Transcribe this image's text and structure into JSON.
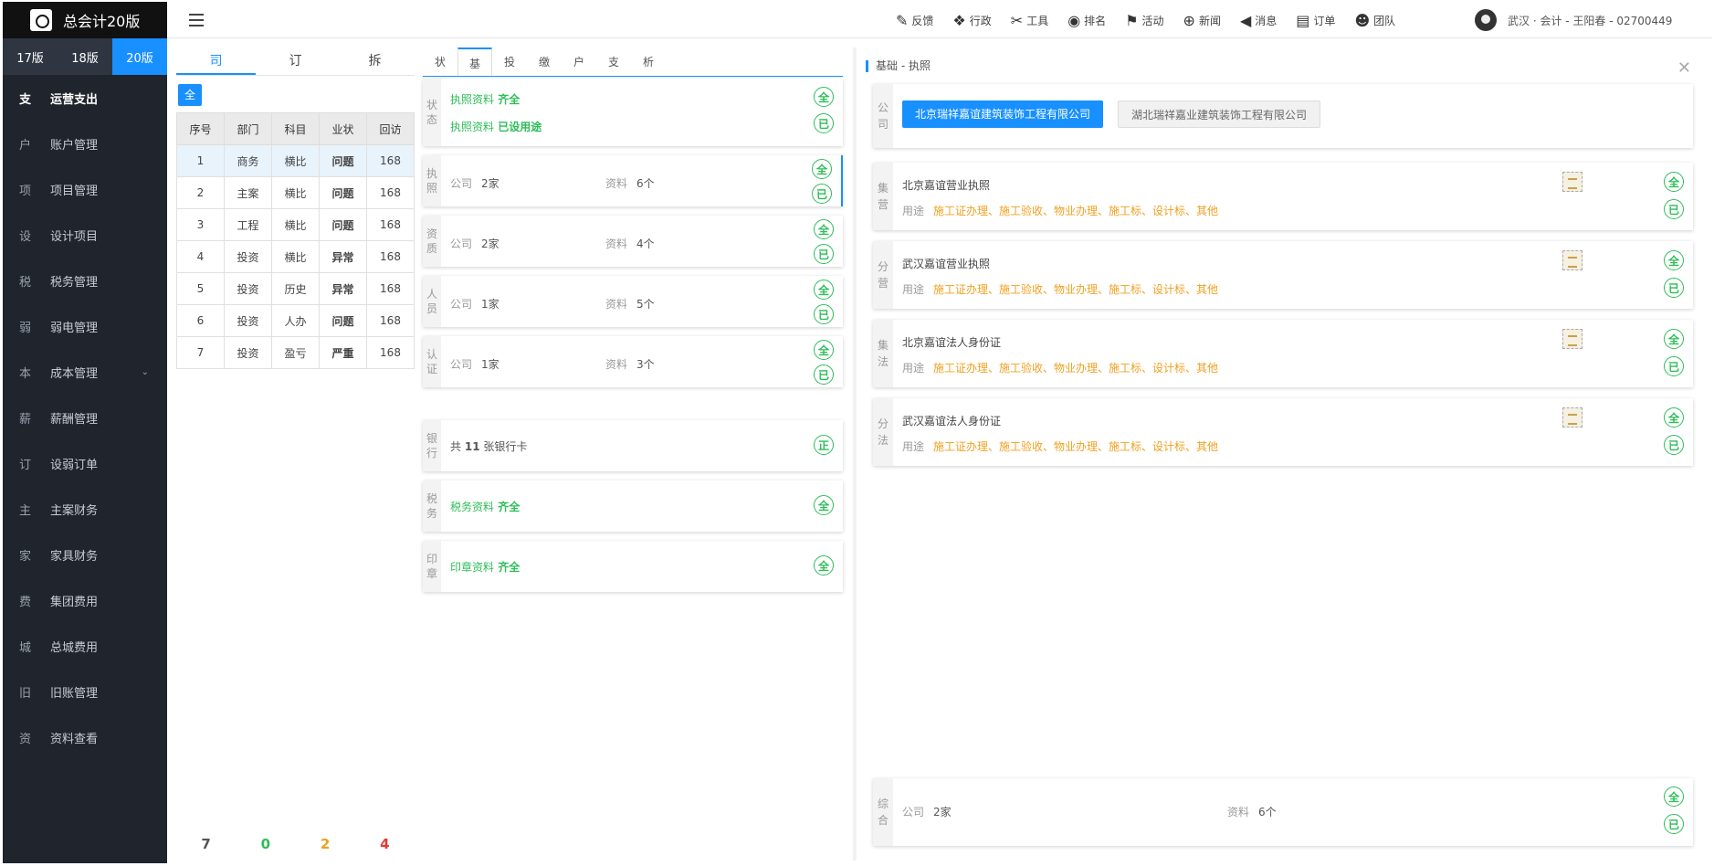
{
  "app": {
    "title": "总会计20版"
  },
  "versions": [
    {
      "label": "17版"
    },
    {
      "label": "18版"
    },
    {
      "label": "20版"
    }
  ],
  "sidebar": {
    "items": [
      {
        "abbr": "支",
        "label": "运营支出"
      },
      {
        "abbr": "户",
        "label": "账户管理"
      },
      {
        "abbr": "项",
        "label": "项目管理"
      },
      {
        "abbr": "设",
        "label": "设计项目"
      },
      {
        "abbr": "税",
        "label": "税务管理"
      },
      {
        "abbr": "弱",
        "label": "弱电管理"
      },
      {
        "abbr": "本",
        "label": "成本管理",
        "chevron": "⌄"
      },
      {
        "abbr": "薪",
        "label": "薪酬管理"
      },
      {
        "abbr": "订",
        "label": "设弱订单"
      },
      {
        "abbr": "主",
        "label": "主案财务"
      },
      {
        "abbr": "家",
        "label": "家具财务"
      },
      {
        "abbr": "费",
        "label": "集团费用"
      },
      {
        "abbr": "城",
        "label": "总城费用"
      },
      {
        "abbr": "旧",
        "label": "旧账管理"
      },
      {
        "abbr": "资",
        "label": "资料查看"
      }
    ]
  },
  "topnav": [
    {
      "icon": "edit-icon",
      "glyph": "✎",
      "label": "反馈"
    },
    {
      "icon": "layers-icon",
      "glyph": "❖",
      "label": "行政"
    },
    {
      "icon": "tools-icon",
      "glyph": "✂",
      "label": "工具"
    },
    {
      "icon": "ranking-icon",
      "glyph": "◉",
      "label": "排名"
    },
    {
      "icon": "flag-icon",
      "glyph": "⚑",
      "label": "活动"
    },
    {
      "icon": "globe-icon",
      "glyph": "⊕",
      "label": "新闻"
    },
    {
      "icon": "speaker-icon",
      "glyph": "◀",
      "label": "消息"
    },
    {
      "icon": "clipboard-icon",
      "glyph": "▤",
      "label": "订单"
    },
    {
      "icon": "team-icon",
      "glyph": "☻",
      "label": "团队"
    }
  ],
  "user": {
    "text": "武汉 · 会计 - 王阳春 - 02700449"
  },
  "col1": {
    "tabs": [
      "司",
      "订",
      "拆"
    ],
    "all_label": "全",
    "headers": [
      "序号",
      "部门",
      "科目",
      "业状",
      "回访"
    ],
    "rows": [
      {
        "no": "1",
        "dept": "商务",
        "subj": "横比",
        "status": "问题",
        "visit": "168"
      },
      {
        "no": "2",
        "dept": "主案",
        "subj": "横比",
        "status": "问题",
        "visit": "168"
      },
      {
        "no": "3",
        "dept": "工程",
        "subj": "横比",
        "status": "问题",
        "visit": "168"
      },
      {
        "no": "4",
        "dept": "投资",
        "subj": "横比",
        "status": "异常",
        "visit": "168"
      },
      {
        "no": "5",
        "dept": "投资",
        "subj": "历史",
        "status": "异常",
        "visit": "168"
      },
      {
        "no": "6",
        "dept": "投资",
        "subj": "人办",
        "status": "问题",
        "visit": "168"
      },
      {
        "no": "7",
        "dept": "投资",
        "subj": "盈亏",
        "status": "严重",
        "visit": "168"
      }
    ],
    "counts": [
      "7",
      "0",
      "2",
      "4"
    ]
  },
  "col2": {
    "tabs": [
      "状",
      "基",
      "投",
      "缴",
      "户",
      "支",
      "析"
    ],
    "status_card": {
      "label": "状态",
      "line1_a": "执照资料",
      "line1_b": "齐全",
      "line2_a": "执照资料",
      "line2_b": "已设用途",
      "b1": "全",
      "b2": "已"
    },
    "cards": [
      {
        "label": "执照",
        "k1": "公司",
        "v1": "2家",
        "k2": "资料",
        "v2": "6个",
        "b1": "全",
        "b2": "已"
      },
      {
        "label": "资质",
        "k1": "公司",
        "v1": "2家",
        "k2": "资料",
        "v2": "4个",
        "b1": "全",
        "b2": "已"
      },
      {
        "label": "人员",
        "k1": "公司",
        "v1": "1家",
        "k2": "资料",
        "v2": "5个",
        "b1": "全",
        "b2": "已"
      },
      {
        "label": "认证",
        "k1": "公司",
        "v1": "1家",
        "k2": "资料",
        "v2": "3个",
        "b1": "全",
        "b2": "已"
      }
    ],
    "bank": {
      "label": "银行",
      "pre": "共",
      "num": "11",
      "post": "张银行卡",
      "badge": "正"
    },
    "tax": {
      "label": "税务",
      "a": "税务资料",
      "b": "齐全",
      "badge": "全"
    },
    "seal": {
      "label": "印章",
      "a": "印章资料",
      "b": "齐全",
      "badge": "全"
    }
  },
  "col3": {
    "title": "基础 - 执照",
    "company_label": "公司",
    "companies": [
      "北京瑞祥嘉谊建筑装饰工程有限公司",
      "湖北瑞祥嘉业建筑装饰工程有限公司"
    ],
    "use_label": "用途",
    "licenses": [
      {
        "label": "集营",
        "name": "北京嘉谊营业执照",
        "use": "施工证办理、施工验收、物业办理、施工标、设计标、其他"
      },
      {
        "label": "分营",
        "name": "武汉嘉谊营业执照",
        "use": "施工证办理、施工验收、物业办理、施工标、设计标、其他"
      },
      {
        "label": "集法",
        "name": "北京嘉谊法人身份证",
        "use": "施工证办理、施工验收、物业办理、施工标、设计标、其他"
      },
      {
        "label": "分法",
        "name": "武汉嘉谊法人身份证",
        "use": "施工证办理、施工验收、物业办理、施工标、设计标、其他"
      }
    ],
    "summary": {
      "label": "综合",
      "k1": "公司",
      "v1": "2家",
      "k2": "资料",
      "v2": "6个"
    },
    "b1": "全",
    "b2": "已"
  }
}
